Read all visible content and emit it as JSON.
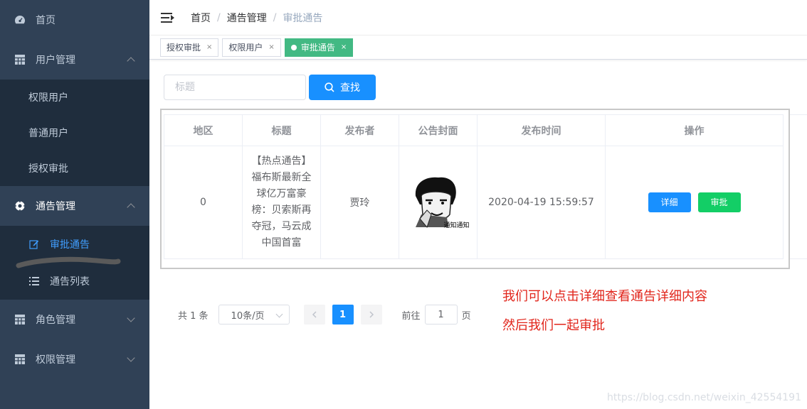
{
  "sidebar": {
    "items": [
      {
        "label": "首页",
        "icon": "dashboard-icon"
      },
      {
        "label": "用户管理",
        "icon": "table-icon"
      },
      {
        "label": "权限用户"
      },
      {
        "label": "普通用户"
      },
      {
        "label": "授权审批"
      },
      {
        "label": "通告管理",
        "icon": "gear-icon"
      },
      {
        "label": "审批通告",
        "icon": "edit-icon"
      },
      {
        "label": "通告列表",
        "icon": "list-icon"
      },
      {
        "label": "角色管理",
        "icon": "table-icon"
      },
      {
        "label": "权限管理",
        "icon": "table-icon"
      }
    ],
    "bg_color": "#304156",
    "submenu_bg_color": "#1f2d3d",
    "active_color": "#409eff"
  },
  "header": {
    "breadcrumb": [
      "首页",
      "通告管理",
      "审批通告"
    ],
    "separator": "/"
  },
  "tags": [
    {
      "label": "授权审批",
      "close": "×",
      "active": false
    },
    {
      "label": "权限用户",
      "close": "×",
      "active": false
    },
    {
      "label": "审批通告",
      "close": "×",
      "active": true
    }
  ],
  "search": {
    "placeholder": "标题",
    "value": "",
    "button_label": "查找"
  },
  "table": {
    "headers": [
      "地区",
      "标题",
      "发布者",
      "公告封面",
      "发布时间",
      "操作"
    ],
    "rows": [
      {
        "region": "0",
        "title": "【热点通告】福布斯最新全球亿万富豪榜：贝索斯再夺冠，马云成中国首富",
        "publisher": "贾玲",
        "cover_caption": "通知通知",
        "time": "2020-04-19 15:59:57",
        "detail_label": "详细",
        "approve_label": "审批"
      }
    ]
  },
  "pagination": {
    "total": "共 1 条",
    "page_size": "10条/页",
    "current_page": "1",
    "goto_prefix": "前往",
    "goto_value": "1",
    "goto_suffix": "页"
  },
  "annotations": [
    "我们可以点击详细查看通告详细内容",
    "然后我们一起审批"
  ],
  "watermark": "https://blog.csdn.net/weixin_42554191",
  "colors": {
    "primary": "#1890ff",
    "success": "#13ce66",
    "tag_active": "#42b983",
    "annotation": "#e1251b"
  }
}
